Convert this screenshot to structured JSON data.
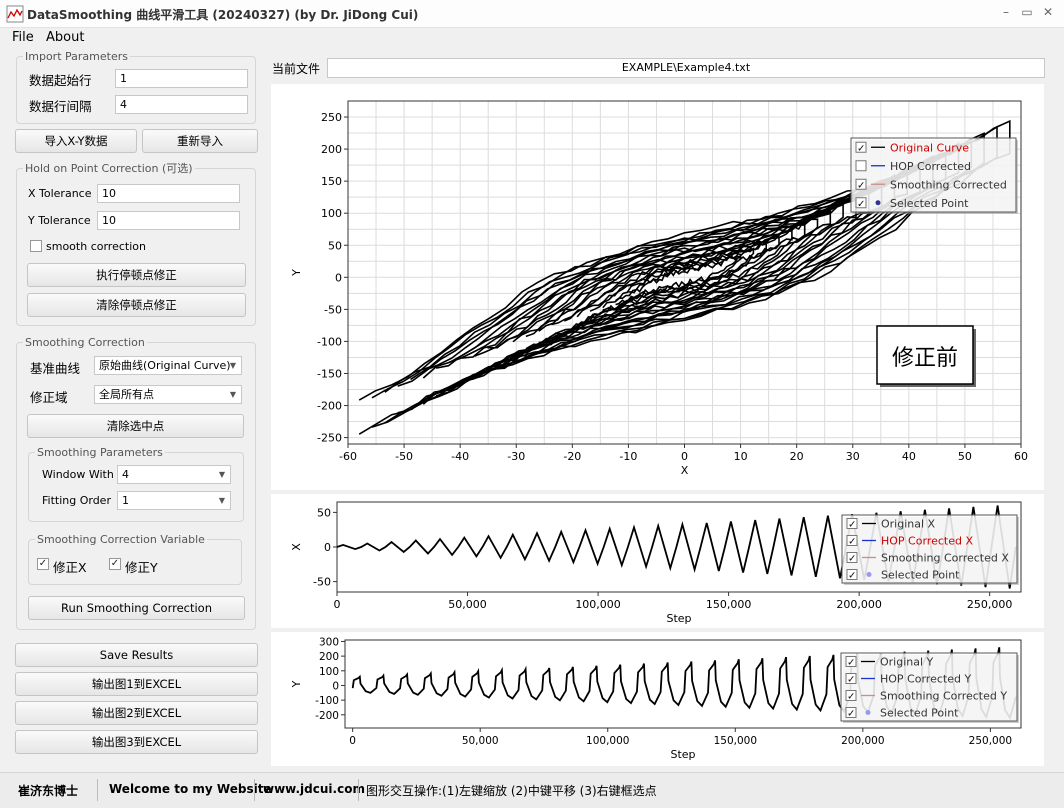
{
  "window": {
    "title": "DataSmoothing 曲线平滑工具 (20240327) (by Dr. JiDong Cui)",
    "minimize": "–",
    "maximize": "▭",
    "close": "✕"
  },
  "menu": {
    "file": "File",
    "about": "About"
  },
  "import_params": {
    "legend": "Import Parameters",
    "start_row_label": "数据起始行",
    "start_row_value": "1",
    "row_interval_label": "数据行间隔",
    "row_interval_value": "4"
  },
  "import_buttons": {
    "import_xy": "导入X-Y数据",
    "reimport": "重新导入"
  },
  "hop": {
    "legend": "Hold on Point Correction (可选)",
    "x_tol_label": "X Tolerance",
    "x_tol_value": "10",
    "y_tol_label": "Y Tolerance",
    "y_tol_value": "10",
    "smooth_correction_label": "smooth correction",
    "smooth_correction_checked": false,
    "run_button": "执行停顿点修正",
    "clear_button": "清除停顿点修正"
  },
  "smoothing": {
    "legend": "Smoothing Correction",
    "base_curve_label": "基准曲线",
    "base_curve_value": "原始曲线(Original Curve)",
    "domain_label": "修正域",
    "domain_value": "全局所有点",
    "clear_selected_button": "清除选中点",
    "params_legend": "Smoothing Parameters",
    "window_label": "Window With",
    "window_value": "4",
    "order_label": "Fitting Order",
    "order_value": "1",
    "variable_legend": "Smoothing Correction Variable",
    "fix_x_label": "修正X",
    "fix_x_checked": true,
    "fix_y_label": "修正Y",
    "fix_y_checked": true,
    "run_button": "Run Smoothing Correction"
  },
  "output_buttons": {
    "save": "Save Results",
    "export1": "输出图1到EXCEL",
    "export2": "输出图2到EXCEL",
    "export3": "输出图3到EXCEL"
  },
  "file": {
    "label": "当前文件",
    "path": "EXAMPLE\\Example4.txt"
  },
  "chart_data": [
    {
      "type": "line",
      "xlabel": "X",
      "ylabel": "Y",
      "xlim": [
        -60,
        60
      ],
      "ylim": [
        -260,
        275
      ],
      "xticks": [
        -60,
        -50,
        -40,
        -30,
        -20,
        -10,
        0,
        10,
        20,
        30,
        40,
        50,
        60
      ],
      "yticks": [
        -250,
        -200,
        -150,
        -100,
        -50,
        0,
        50,
        100,
        150,
        200,
        250
      ],
      "grid": true,
      "annotation": "修正前",
      "legend_position": "top-right",
      "legend": [
        {
          "name": "Original Curve",
          "checked": true,
          "color": "#000000",
          "text_color": "#cc0000",
          "marker": "line"
        },
        {
          "name": "HOP Corrected",
          "checked": false,
          "color": "#1a33cc",
          "text_color": "#333333",
          "marker": "line"
        },
        {
          "name": "Smoothing Corrected",
          "checked": true,
          "color": "#d08a8a",
          "text_color": "#333333",
          "marker": "line"
        },
        {
          "name": "Selected Point",
          "checked": true,
          "color": "#333399",
          "text_color": "#333333",
          "marker": "dot"
        }
      ],
      "series": [
        {
          "name": "Original Curve",
          "style": "hysteresis",
          "points": [
            [
              -60,
              -255
            ],
            [
              -50,
              -160
            ],
            [
              -42,
              -60
            ],
            [
              -30,
              -10
            ],
            [
              -10,
              20
            ],
            [
              10,
              50
            ],
            [
              30,
              80
            ],
            [
              50,
              130
            ],
            [
              60,
              270
            ],
            [
              55,
              150
            ],
            [
              45,
              110
            ],
            [
              30,
              90
            ],
            [
              10,
              60
            ],
            [
              -5,
              20
            ],
            [
              -20,
              -30
            ],
            [
              -35,
              -100
            ],
            [
              -50,
              -190
            ],
            [
              -55,
              -255
            ]
          ]
        }
      ]
    },
    {
      "type": "line",
      "xlabel": "Step",
      "ylabel": "X",
      "xlim": [
        0,
        262000
      ],
      "ylim": [
        -65,
        65
      ],
      "xticks": [
        0,
        50000,
        100000,
        150000,
        200000,
        250000
      ],
      "xtick_labels": [
        "0",
        "50,000",
        "100,000",
        "150,000",
        "200,000",
        "250,000"
      ],
      "yticks": [
        -50,
        0,
        50
      ],
      "grid": false,
      "legend_position": "top-right",
      "legend": [
        {
          "name": "Original X",
          "checked": true,
          "color": "#000000",
          "text_color": "#333333",
          "marker": "line"
        },
        {
          "name": "HOP Corrected X",
          "checked": true,
          "color": "#1a33cc",
          "text_color": "#cc0000",
          "marker": "line"
        },
        {
          "name": "Smoothing Corrected X",
          "checked": true,
          "color": "#d08a8a",
          "text_color": "#333333",
          "marker": "line"
        },
        {
          "name": "Selected Point",
          "checked": true,
          "color": "#9999ee",
          "text_color": "#333333",
          "marker": "dot"
        }
      ],
      "series": [
        {
          "name": "Original X",
          "style": "growing-triangle",
          "cycles": 28,
          "start_amplitude": 3,
          "end_amplitude": 60
        }
      ]
    },
    {
      "type": "line",
      "xlabel": "Step",
      "ylabel": "Y",
      "xlim": [
        -3000,
        262000
      ],
      "ylim": [
        -290,
        310
      ],
      "xticks": [
        0,
        50000,
        100000,
        150000,
        200000,
        250000
      ],
      "xtick_labels": [
        "0",
        "50,000",
        "100,000",
        "150,000",
        "200,000",
        "250,000"
      ],
      "yticks": [
        -200,
        -100,
        0,
        100,
        200,
        300
      ],
      "grid": false,
      "legend_position": "top-right",
      "legend": [
        {
          "name": "Original Y",
          "checked": true,
          "color": "#000000",
          "text_color": "#333333",
          "marker": "line"
        },
        {
          "name": "HOP Corrected Y",
          "checked": true,
          "color": "#1a33cc",
          "text_color": "#333333",
          "marker": "line"
        },
        {
          "name": "Smoothing Corrected Y",
          "checked": true,
          "color": "#d08a8a",
          "text_color": "#333333",
          "marker": "line"
        },
        {
          "name": "Selected Point",
          "checked": true,
          "color": "#9999ee",
          "text_color": "#333333",
          "marker": "dot"
        }
      ],
      "series": [
        {
          "name": "Original Y",
          "style": "growing-sawtooth",
          "cycles": 28,
          "start_amplitude": 60,
          "end_amplitude": 260
        }
      ]
    }
  ],
  "status": {
    "author": "崔济东博士",
    "welcome": "Welcome to my Website",
    "site": "www.jdcui.com",
    "hint": "图形交互操作:(1)左键缩放 (2)中键平移 (3)右键框选点"
  }
}
